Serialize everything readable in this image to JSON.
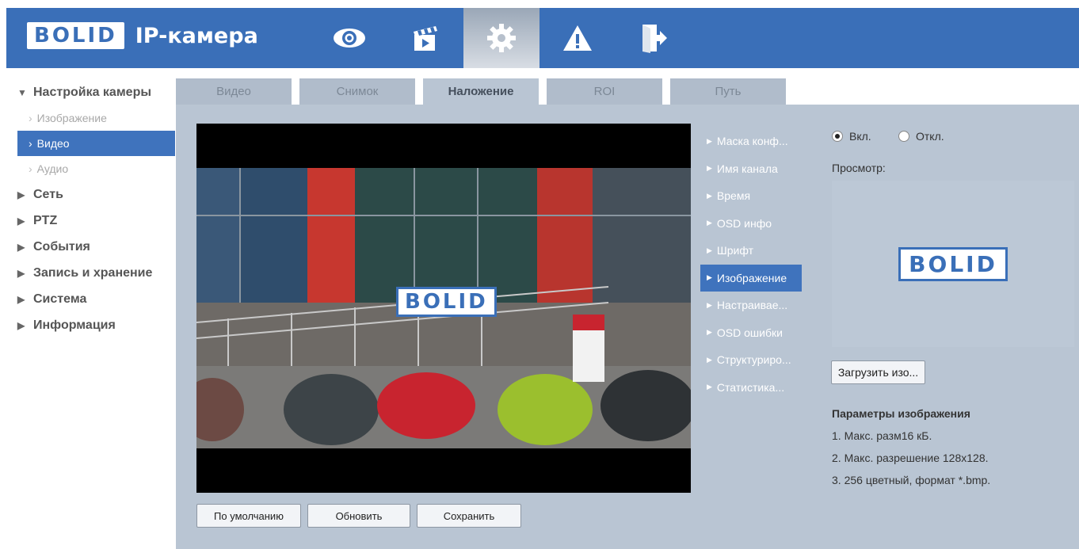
{
  "header": {
    "logo_text": "BOLID",
    "app_title": "IP-камера",
    "nav_icons": [
      "eye-icon",
      "clapperboard-icon",
      "gear-icon",
      "warning-icon",
      "exit-icon"
    ],
    "active_nav": "gear-icon",
    "bg_color": "#3a6fb8"
  },
  "sidebar": {
    "groups": [
      {
        "label": "Настройка камеры",
        "expanded": true,
        "items": [
          {
            "label": "Изображение",
            "active": false
          },
          {
            "label": "Видео",
            "active": true
          },
          {
            "label": "Аудио",
            "active": false
          }
        ]
      },
      {
        "label": "Сеть",
        "expanded": false
      },
      {
        "label": "PTZ",
        "expanded": false
      },
      {
        "label": "События",
        "expanded": false
      },
      {
        "label": "Запись и хранение",
        "expanded": false
      },
      {
        "label": "Система",
        "expanded": false
      },
      {
        "label": "Информация",
        "expanded": false
      }
    ]
  },
  "tabs": [
    {
      "label": "Видео",
      "active": false
    },
    {
      "label": "Снимок",
      "active": false
    },
    {
      "label": "Наложение",
      "active": true
    },
    {
      "label": "ROI",
      "active": false
    },
    {
      "label": "Путь",
      "active": false
    }
  ],
  "video": {
    "overlay_logo_text": "BOLID"
  },
  "overlay_menu": [
    {
      "label": "Маска конф...",
      "active": false
    },
    {
      "label": "Имя канала",
      "active": false
    },
    {
      "label": "Время",
      "active": false
    },
    {
      "label": "OSD инфо",
      "active": false
    },
    {
      "label": "Шрифт",
      "active": false
    },
    {
      "label": "Изображение",
      "active": true
    },
    {
      "label": "Настраивае...",
      "active": false
    },
    {
      "label": "OSD ошибки",
      "active": false
    },
    {
      "label": "Структуриро...",
      "active": false
    },
    {
      "label": "Статистика...",
      "active": false
    }
  ],
  "settings": {
    "enable_on_label": "Вкл.",
    "enable_off_label": "Откл.",
    "enabled": true,
    "preview_label": "Просмотр:",
    "preview_logo_text": "BOLID",
    "upload_button": "Загрузить изо...",
    "params_title": "Параметры изображения",
    "params": [
      "1. Макс. разм16 кБ.",
      "2. Макс. разрешение 128x128.",
      "3. 256 цветный, формат *.bmp."
    ]
  },
  "buttons": {
    "default": "По умолчанию",
    "refresh": "Обновить",
    "save": "Сохранить"
  }
}
